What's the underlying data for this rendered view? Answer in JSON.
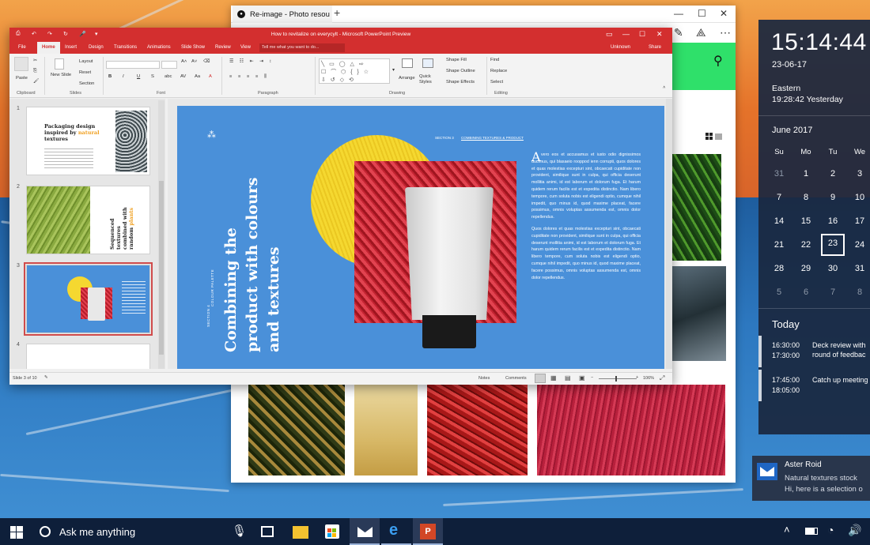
{
  "photos_window": {
    "tab_title": "Re-image - Photo resou",
    "new_tab": "+",
    "minimize": "—",
    "maximize": "☐",
    "close": "✕"
  },
  "ppt": {
    "quick_access": [
      "⎙",
      "↶",
      "↷",
      "↻",
      "🎤",
      "▾"
    ],
    "title": "How to revitalize on everycylt - Microsoft PowerPoint Preview",
    "tabs": [
      "File",
      "Home",
      "Insert",
      "Design",
      "Transitions",
      "Animations",
      "Slide Show",
      "Review",
      "View"
    ],
    "active_tab": "Home",
    "tell_me": "Tell me what you want to do...",
    "user": "Unknown",
    "share": "Share",
    "ribbon": {
      "paste": "Paste",
      "clipboard": "Clipboard",
      "new_slide": "New Slide",
      "layout": "Layout",
      "reset": "Reset",
      "section": "Section",
      "slides": "Slides",
      "font": "Font",
      "paragraph": "Paragraph",
      "drawing": "Drawing",
      "arrange": "Arrange",
      "quick_styles": "Quick Styles",
      "shape_fill": "Shape Fill",
      "shape_outline": "Shape Outline",
      "shape_effects": "Shape Effects",
      "find": "Find",
      "replace": "Replace",
      "select": "Select",
      "editing": "Editing"
    },
    "thumbnails": [
      {
        "num": "1",
        "title_a": "Packaging design",
        "title_b": "inspired by",
        "title_accent": "natural",
        "title_c": "textures"
      },
      {
        "num": "2",
        "title_a": "Sequenced textures",
        "title_b": "combined with",
        "title_c": "random",
        "title_accent": "plants"
      },
      {
        "num": "3"
      },
      {
        "num": "4"
      }
    ],
    "slide": {
      "section_label": "SECTION 3",
      "section_link": "COMBINING TEXTURES & PRODUCT",
      "headline_1": "Combining the",
      "headline_2": "product with colours",
      "headline_3": "and textures",
      "vertical_small_1": "SECTION 4",
      "vertical_small_2": "COLOUR PALETTE",
      "drop_cap": "A",
      "para1": "vero eos et accusamus et iusto odio dignissimos ducimus, qui blasaeio rooppod ienn corrupti, quos dolores et quas molestias excepturi sint, obcaecati cupiditate non provident, similique sunt in culpa, qui officia deserunt mollitia animi, id est laborum et dolorum fuga. Et harum quidem rerum facilis est et expedita distinctio. Nam libero tempore, cum soluta nobis est eligendi optio, cumque nihil impedit, quo minus id, quod maxime placeat, facere possimus, omnis voluptas assumenda est, omnis dolor repellendus.",
      "para2": "Quos dolores et quas molestias excepturi sint, obcaecati cupiditate non provident, similique sunt in culpa, qui officia deserunt mollitia animi, id est laborum et dolorum fuga. Et harum quidem rerum facilis est et expedita distinctio. Nam libero tempore, cum soluta nobis est eligendi optio, cumque nihil impedit, quo minus id, quod maxime placeat, facere possimus, omnis voluptas assumenda est, omnis dolor repellendus."
    },
    "status": {
      "slide_of": "Slide 3 of 10",
      "notes": "Notes",
      "comments": "Comments",
      "zoom": "106%"
    }
  },
  "calendar": {
    "time": "15:14:44",
    "date": "23-06-17",
    "zone": "Eastern",
    "zone_time": "19:28:42 Yesterday",
    "month": "June 2017",
    "days_of_week": [
      "Su",
      "Mo",
      "Tu",
      "We"
    ],
    "weeks": [
      [
        "31",
        "1",
        "2",
        "3"
      ],
      [
        "7",
        "8",
        "9",
        "10"
      ],
      [
        "14",
        "15",
        "16",
        "17"
      ],
      [
        "21",
        "22",
        "23",
        "24"
      ],
      [
        "28",
        "29",
        "30",
        "31"
      ],
      [
        "5",
        "6",
        "7",
        "8"
      ]
    ],
    "today_label": "Today",
    "events": [
      {
        "start": "16:30:00",
        "end": "17:30:00",
        "title": "Deck review with",
        "title2": "round of feedbac"
      },
      {
        "start": "17:45:00",
        "end": "18:05:00",
        "title": "Catch up meeting",
        "title2": ""
      }
    ]
  },
  "toast": {
    "sender": "Aster Roid",
    "line1": "Natural textures stock",
    "line2": "Hi, here is a selection o"
  },
  "taskbar": {
    "search_placeholder": "Ask me anything"
  },
  "colors": {
    "ppt_red": "#d32f2f",
    "slide_blue": "#4a90d9",
    "accent_green": "#2fe06a",
    "yellow": "#f5d830",
    "orange_accent": "#f0a020"
  }
}
